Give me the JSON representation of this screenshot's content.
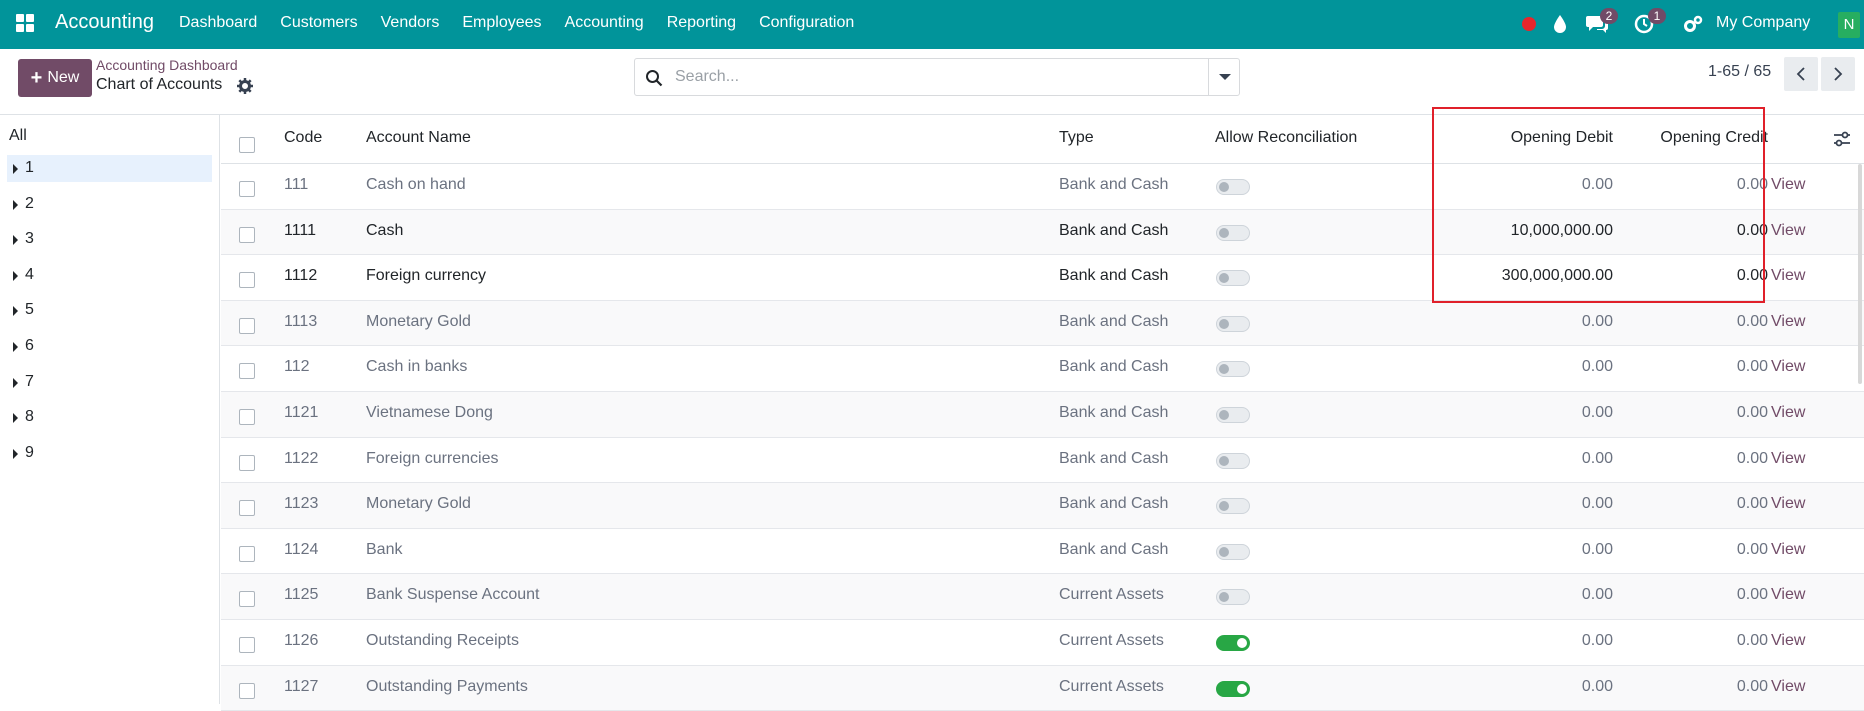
{
  "app": {
    "name": "Accounting"
  },
  "menu": [
    "Dashboard",
    "Customers",
    "Vendors",
    "Employees",
    "Accounting",
    "Reporting",
    "Configuration"
  ],
  "systray": {
    "messages_count": "2",
    "activities_count": "1",
    "company": "My Company",
    "avatar_letter": "N"
  },
  "control": {
    "new_label": "New",
    "breadcrumb_parent": "Accounting Dashboard",
    "breadcrumb_current": "Chart of Accounts",
    "search_placeholder": "Search...",
    "pager": "1-65 / 65"
  },
  "sidebar": {
    "all_label": "All",
    "items": [
      "1",
      "2",
      "3",
      "4",
      "5",
      "6",
      "7",
      "8",
      "9"
    ],
    "active_item": "1"
  },
  "table": {
    "columns": {
      "code": "Code",
      "name": "Account Name",
      "type": "Type",
      "reconcile": "Allow Reconciliation",
      "debit": "Opening Debit",
      "credit": "Opening Credit"
    },
    "view_label": "View",
    "rows": [
      {
        "code": "111",
        "name": "Cash on hand",
        "type": "Bank and Cash",
        "reconcile": false,
        "debit": "0.00",
        "credit": "0.00",
        "bold": false
      },
      {
        "code": "1111",
        "name": "Cash",
        "type": "Bank and Cash",
        "reconcile": false,
        "debit": "10,000,000.00",
        "credit": "0.00",
        "bold": true
      },
      {
        "code": "1112",
        "name": "Foreign currency",
        "type": "Bank and Cash",
        "reconcile": false,
        "debit": "300,000,000.00",
        "credit": "0.00",
        "bold": true
      },
      {
        "code": "1113",
        "name": "Monetary Gold",
        "type": "Bank and Cash",
        "reconcile": false,
        "debit": "0.00",
        "credit": "0.00",
        "bold": false
      },
      {
        "code": "112",
        "name": "Cash in banks",
        "type": "Bank and Cash",
        "reconcile": false,
        "debit": "0.00",
        "credit": "0.00",
        "bold": false
      },
      {
        "code": "1121",
        "name": "Vietnamese Dong",
        "type": "Bank and Cash",
        "reconcile": false,
        "debit": "0.00",
        "credit": "0.00",
        "bold": false
      },
      {
        "code": "1122",
        "name": "Foreign currencies",
        "type": "Bank and Cash",
        "reconcile": false,
        "debit": "0.00",
        "credit": "0.00",
        "bold": false
      },
      {
        "code": "1123",
        "name": "Monetary Gold",
        "type": "Bank and Cash",
        "reconcile": false,
        "debit": "0.00",
        "credit": "0.00",
        "bold": false
      },
      {
        "code": "1124",
        "name": "Bank",
        "type": "Bank and Cash",
        "reconcile": false,
        "debit": "0.00",
        "credit": "0.00",
        "bold": false
      },
      {
        "code": "1125",
        "name": "Bank Suspense Account",
        "type": "Current Assets",
        "reconcile": false,
        "debit": "0.00",
        "credit": "0.00",
        "bold": false
      },
      {
        "code": "1126",
        "name": "Outstanding Receipts",
        "type": "Current Assets",
        "reconcile": true,
        "debit": "0.00",
        "credit": "0.00",
        "bold": false
      },
      {
        "code": "1127",
        "name": "Outstanding Payments",
        "type": "Current Assets",
        "reconcile": true,
        "debit": "0.00",
        "credit": "0.00",
        "bold": false
      }
    ]
  },
  "colors": {
    "topbar": "#01949a",
    "primary": "#714b67",
    "toggle_on": "#28a745",
    "highlight": "#e0202a"
  }
}
